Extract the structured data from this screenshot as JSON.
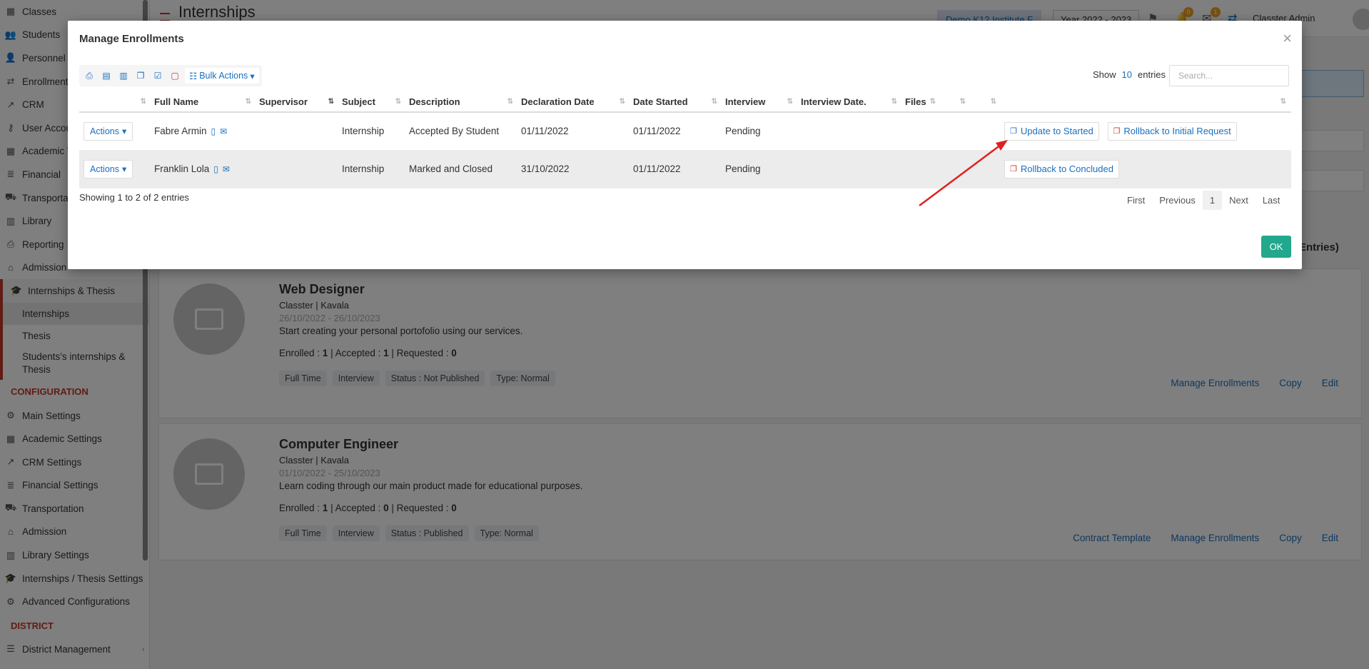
{
  "sidebar": {
    "items": [
      {
        "label": "Classes"
      },
      {
        "label": "Students"
      },
      {
        "label": "Personnel"
      },
      {
        "label": "Enrollment"
      },
      {
        "label": "CRM"
      },
      {
        "label": "User Accou"
      },
      {
        "label": "Academic T"
      },
      {
        "label": "Financial"
      },
      {
        "label": "Transporta"
      },
      {
        "label": "Library"
      },
      {
        "label": "Reporting"
      },
      {
        "label": "Admission"
      }
    ],
    "active_group": "Internships & Thesis",
    "sub_items": [
      "Internships",
      "Thesis",
      "Students's internships & Thesis"
    ],
    "config_section": "CONFIGURATION",
    "config_items": [
      "Main Settings",
      "Academic Settings",
      "CRM Settings",
      "Financial Settings",
      "Transportation",
      "Admission",
      "Library Settings",
      "Internships / Thesis Settings",
      "Advanced Configurations"
    ],
    "district_section": "DISTRICT",
    "district_items": [
      "District Management"
    ]
  },
  "topbar": {
    "title": "Internships",
    "institute": "Demo K12 Institute F",
    "year": "Year 2022 - 2023",
    "user": "Classter Admin",
    "notif_count": "0",
    "msg_count": "1"
  },
  "background": {
    "entries_text": "Entries)",
    "cards": [
      {
        "title": "Web Designer",
        "meta": "Classter | Kavala",
        "dates": "26/10/2022 - 26/10/2023",
        "desc": "Start creating your personal portofolio using our services.",
        "enrolled": "1",
        "accepted": "1",
        "requested": "0",
        "tags": [
          "Full Time",
          "Interview",
          "Status : Not Published",
          "Type: Normal"
        ],
        "actions": [
          "Manage Enrollments",
          "Copy",
          "Edit"
        ]
      },
      {
        "title": "Computer Engineer",
        "meta": "Classter | Kavala",
        "dates": "01/10/2022 - 25/10/2023",
        "desc": "Learn coding through our main product made for educational purposes.",
        "enrolled": "1",
        "accepted": "0",
        "requested": "0",
        "tags": [
          "Full Time",
          "Interview",
          "Status : Published",
          "Type: Normal"
        ],
        "actions": [
          "Contract Template",
          "Manage Enrollments",
          "Copy",
          "Edit"
        ]
      }
    ],
    "labels": {
      "enrolled": "Enrolled : ",
      "accepted": " | Accepted : ",
      "requested": " | Requested : "
    }
  },
  "modal": {
    "title": "Manage Enrollments",
    "bulk_actions": "Bulk Actions",
    "show_label": "Show",
    "page_length": "10",
    "entries_label": "entries",
    "search_placeholder": "Search...",
    "columns": [
      "Full Name",
      "Supervisor",
      "Subject",
      "Description",
      "Declaration Date",
      "Date Started",
      "Interview",
      "Interview Date.",
      "Files",
      "",
      "",
      ""
    ],
    "rows": [
      {
        "actions": "Actions",
        "full_name": "Fabre Armin",
        "supervisor": "",
        "subject": "Internship",
        "description": "Accepted By Student",
        "declaration_date": "01/11/2022",
        "date_started": "01/11/2022",
        "interview": "Pending",
        "interview_date": "",
        "buttons": [
          "Update to Started",
          "Rollback to Initial Request"
        ]
      },
      {
        "actions": "Actions",
        "full_name": "Franklin Lola",
        "supervisor": "",
        "subject": "Internship",
        "description": "Marked and Closed",
        "declaration_date": "31/10/2022",
        "date_started": "01/11/2022",
        "interview": "Pending",
        "interview_date": "",
        "buttons": [
          "Rollback to Concluded"
        ]
      }
    ],
    "info": "Showing 1 to 2 of 2 entries",
    "pager": {
      "first": "First",
      "previous": "Previous",
      "current": "1",
      "next": "Next",
      "last": "Last"
    },
    "ok": "OK"
  },
  "colors": {
    "accent": "#1a6fbf",
    "ok": "#22a88c",
    "brand_red": "#c0392b",
    "annotation_arrow": "#e02020"
  }
}
